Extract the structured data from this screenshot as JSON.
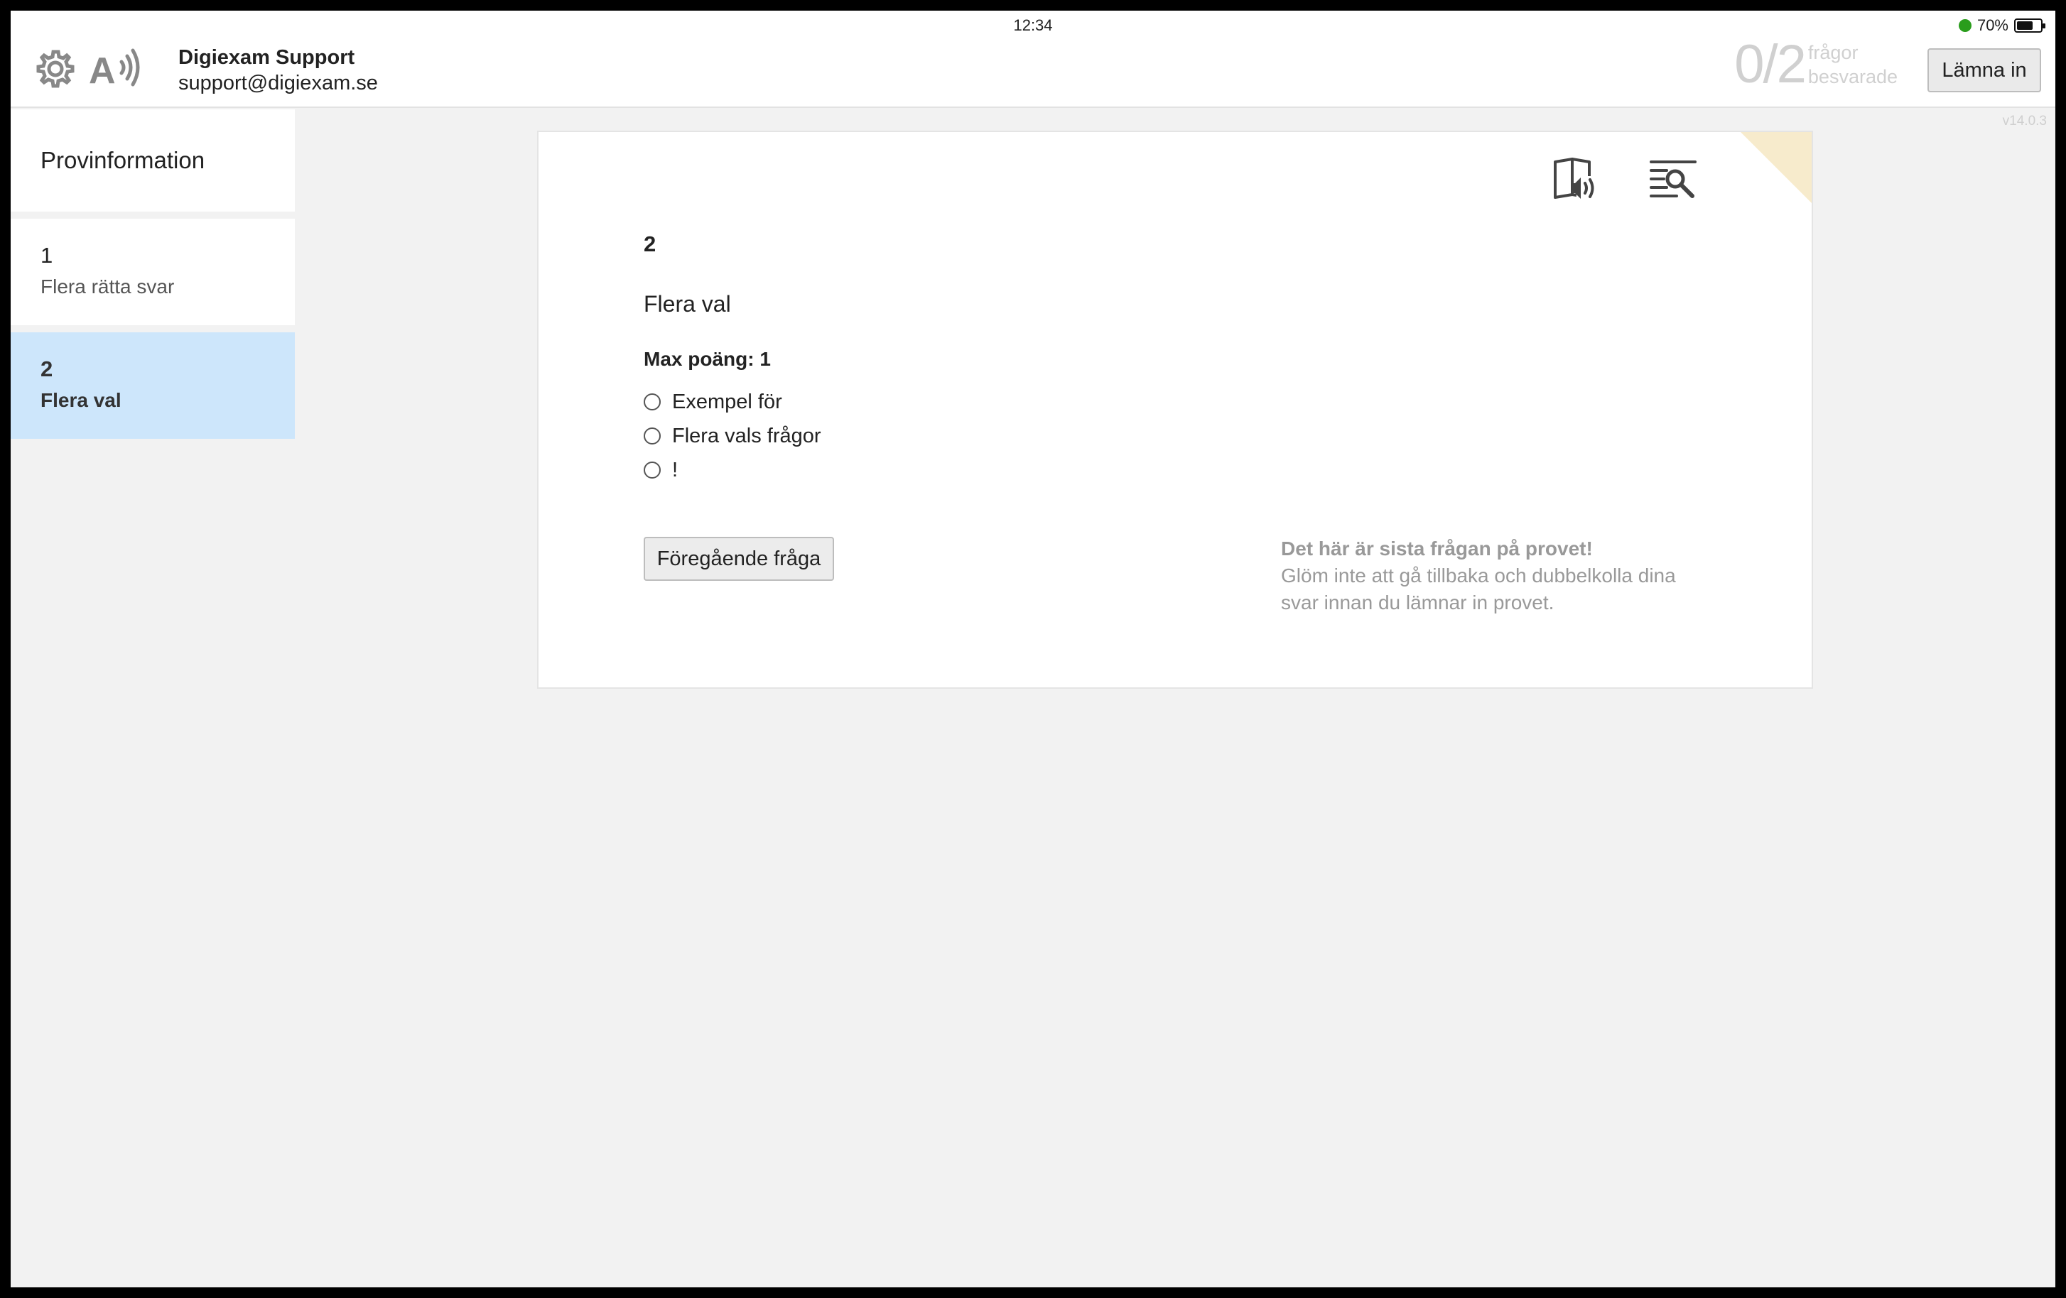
{
  "status": {
    "time": "12:34",
    "battery": "70%",
    "battery_level": 0.7
  },
  "header": {
    "user_name": "Digiexam Support",
    "user_email": "support@digiexam.se",
    "progress_count": "0/2",
    "progress_label_line1": "frågor",
    "progress_label_line2": "besvarade",
    "submit_label": "Lämna in",
    "version": "v14.0.3",
    "icons": [
      "gear-icon",
      "text-to-speech-icon"
    ]
  },
  "sidebar": {
    "info_label": "Provinformation",
    "questions": [
      {
        "number": "1",
        "title": "Flera rätta svar",
        "active": false
      },
      {
        "number": "2",
        "title": "Flera val",
        "active": true
      }
    ]
  },
  "question": {
    "number": "2",
    "title": "Flera val",
    "points": "Max poäng: 1",
    "options": [
      "Exempel för",
      "Flera vals frågor",
      "!"
    ],
    "prev_label": "Föregående fråga",
    "last_title": "Det här är sista frågan på provet!",
    "last_text": "Glöm inte att gå tillbaka och dubbelkolla dina svar innan du lämnar in provet.",
    "icons": [
      "audio-book-icon",
      "search-lines-icon"
    ]
  },
  "colors": {
    "active_item": "#cde6fb",
    "corner": "#f7ebcc",
    "progress": "#d0d0d0"
  }
}
